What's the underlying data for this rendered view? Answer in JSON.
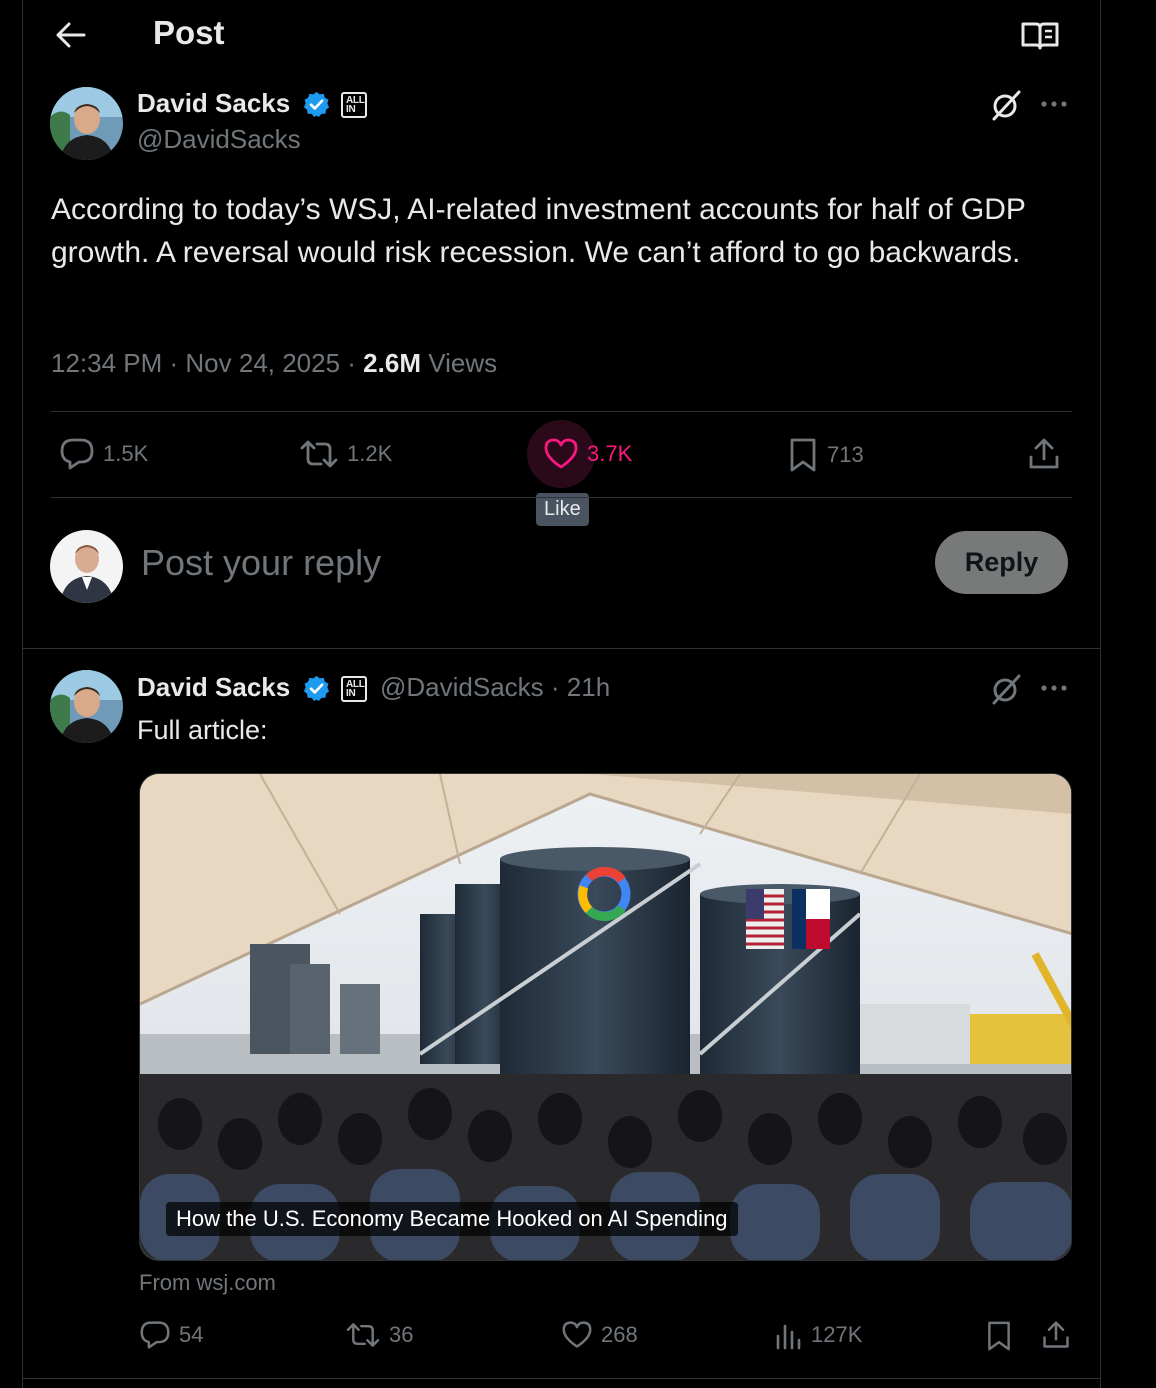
{
  "header": {
    "title": "Post"
  },
  "post": {
    "author": "David Sacks",
    "handle": "@DavidSacks",
    "badge": "ALL IN",
    "text": "According to today’s WSJ, AI-related investment accounts for half of GDP growth. A reversal would risk recession. We can’t afford to go backwards.",
    "time": "12:34 PM · Nov 24, 2025 · ",
    "views_count": "2.6M",
    "views_label": " Views",
    "replies": "1.5K",
    "reposts": "1.2K",
    "likes": "3.7K",
    "bookmarks": "713",
    "like_tooltip": "Like"
  },
  "composer": {
    "placeholder": "Post your reply",
    "button": "Reply"
  },
  "reply": {
    "author": "David Sacks",
    "handle_time": "@DavidSacks · 21h",
    "badge": "ALL IN",
    "text": "Full article:",
    "card_title": "How the U.S. Economy Became Hooked on AI Spending",
    "card_source": "From wsj.com",
    "replies": "54",
    "reposts": "36",
    "likes": "268",
    "views": "127K"
  },
  "colors": {
    "like": "#f91880",
    "verified": "#1d9bf0",
    "muted": "#71767b"
  }
}
